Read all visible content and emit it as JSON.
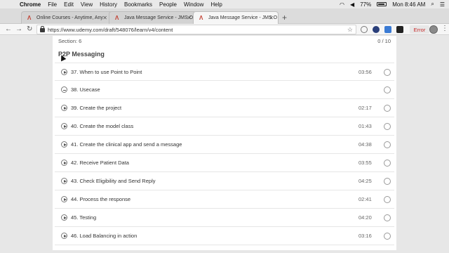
{
  "menubar": {
    "app": "Chrome",
    "items": [
      "File",
      "Edit",
      "View",
      "History",
      "Bookmarks",
      "People",
      "Window",
      "Help"
    ],
    "battery": "77%",
    "clock": "Mon 8:46 AM"
  },
  "tabs": [
    {
      "title": "Online Courses - Anytime, Any",
      "active": false
    },
    {
      "title": "Java Message Service - JMS O",
      "active": false
    },
    {
      "title": "Java Message Service - JMS O",
      "active": true
    }
  ],
  "toolbar": {
    "url": "https://www.udemy.com/draft/548076/learn/v4/content",
    "error_label": "Error"
  },
  "section": {
    "label": "Section: 6",
    "progress": "0 / 10",
    "title": "P2P Messaging"
  },
  "lectures": [
    {
      "title": "37. When to use Point to Point",
      "duration": "03:56",
      "icon": "play"
    },
    {
      "title": "38. Usecase",
      "duration": "",
      "icon": "minus"
    },
    {
      "title": "39. Create the project",
      "duration": "02:17",
      "icon": "play"
    },
    {
      "title": "40. Create the model class",
      "duration": "01:43",
      "icon": "play"
    },
    {
      "title": "41. Create the clinical app and send a message",
      "duration": "04:38",
      "icon": "play"
    },
    {
      "title": "42. Receive Patient Data",
      "duration": "03:55",
      "icon": "play"
    },
    {
      "title": "43. Check Eligibility and Send Reply",
      "duration": "04:25",
      "icon": "play"
    },
    {
      "title": "44. Process the response",
      "duration": "02:41",
      "icon": "play"
    },
    {
      "title": "45. Testing",
      "duration": "04:20",
      "icon": "play"
    },
    {
      "title": "46. Load Balancing in action",
      "duration": "03:16",
      "icon": "play"
    }
  ],
  "colors": {
    "error": "#c62828",
    "favicon": "#c0392b"
  }
}
